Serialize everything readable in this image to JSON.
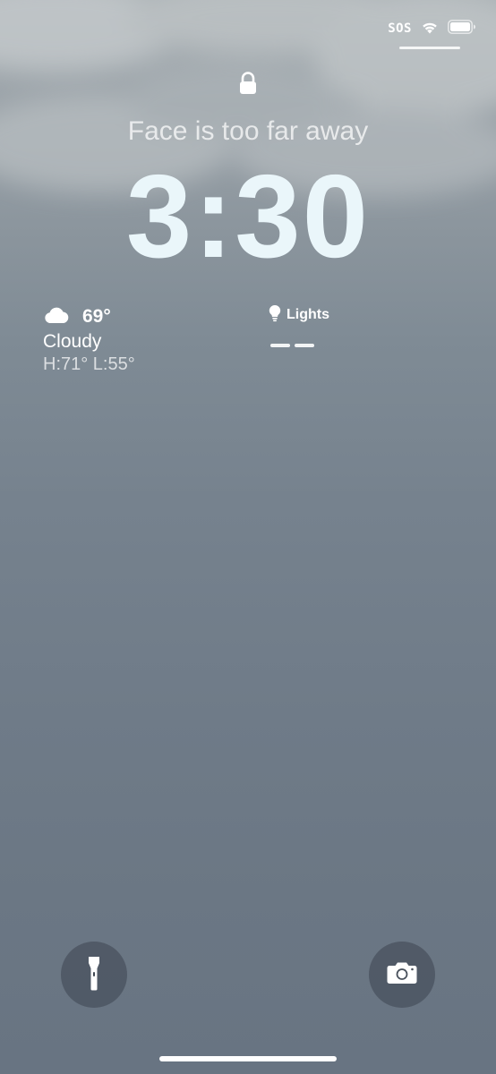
{
  "status_bar": {
    "carrier": "SOS",
    "wifi_icon": "wifi-icon",
    "battery_icon": "battery-icon"
  },
  "lock_screen": {
    "lock_icon": "lock-icon",
    "face_message": "Face is too far away",
    "time": "3:30"
  },
  "weather_widget": {
    "icon": "cloud-icon",
    "temperature": "69°",
    "condition": "Cloudy",
    "high_low": "H:71° L:55°"
  },
  "lights_widget": {
    "icon": "lightbulb-icon",
    "label": "Lights",
    "value": "——"
  },
  "quick_actions": {
    "flashlight_icon": "flashlight-icon",
    "camera_icon": "camera-icon"
  }
}
